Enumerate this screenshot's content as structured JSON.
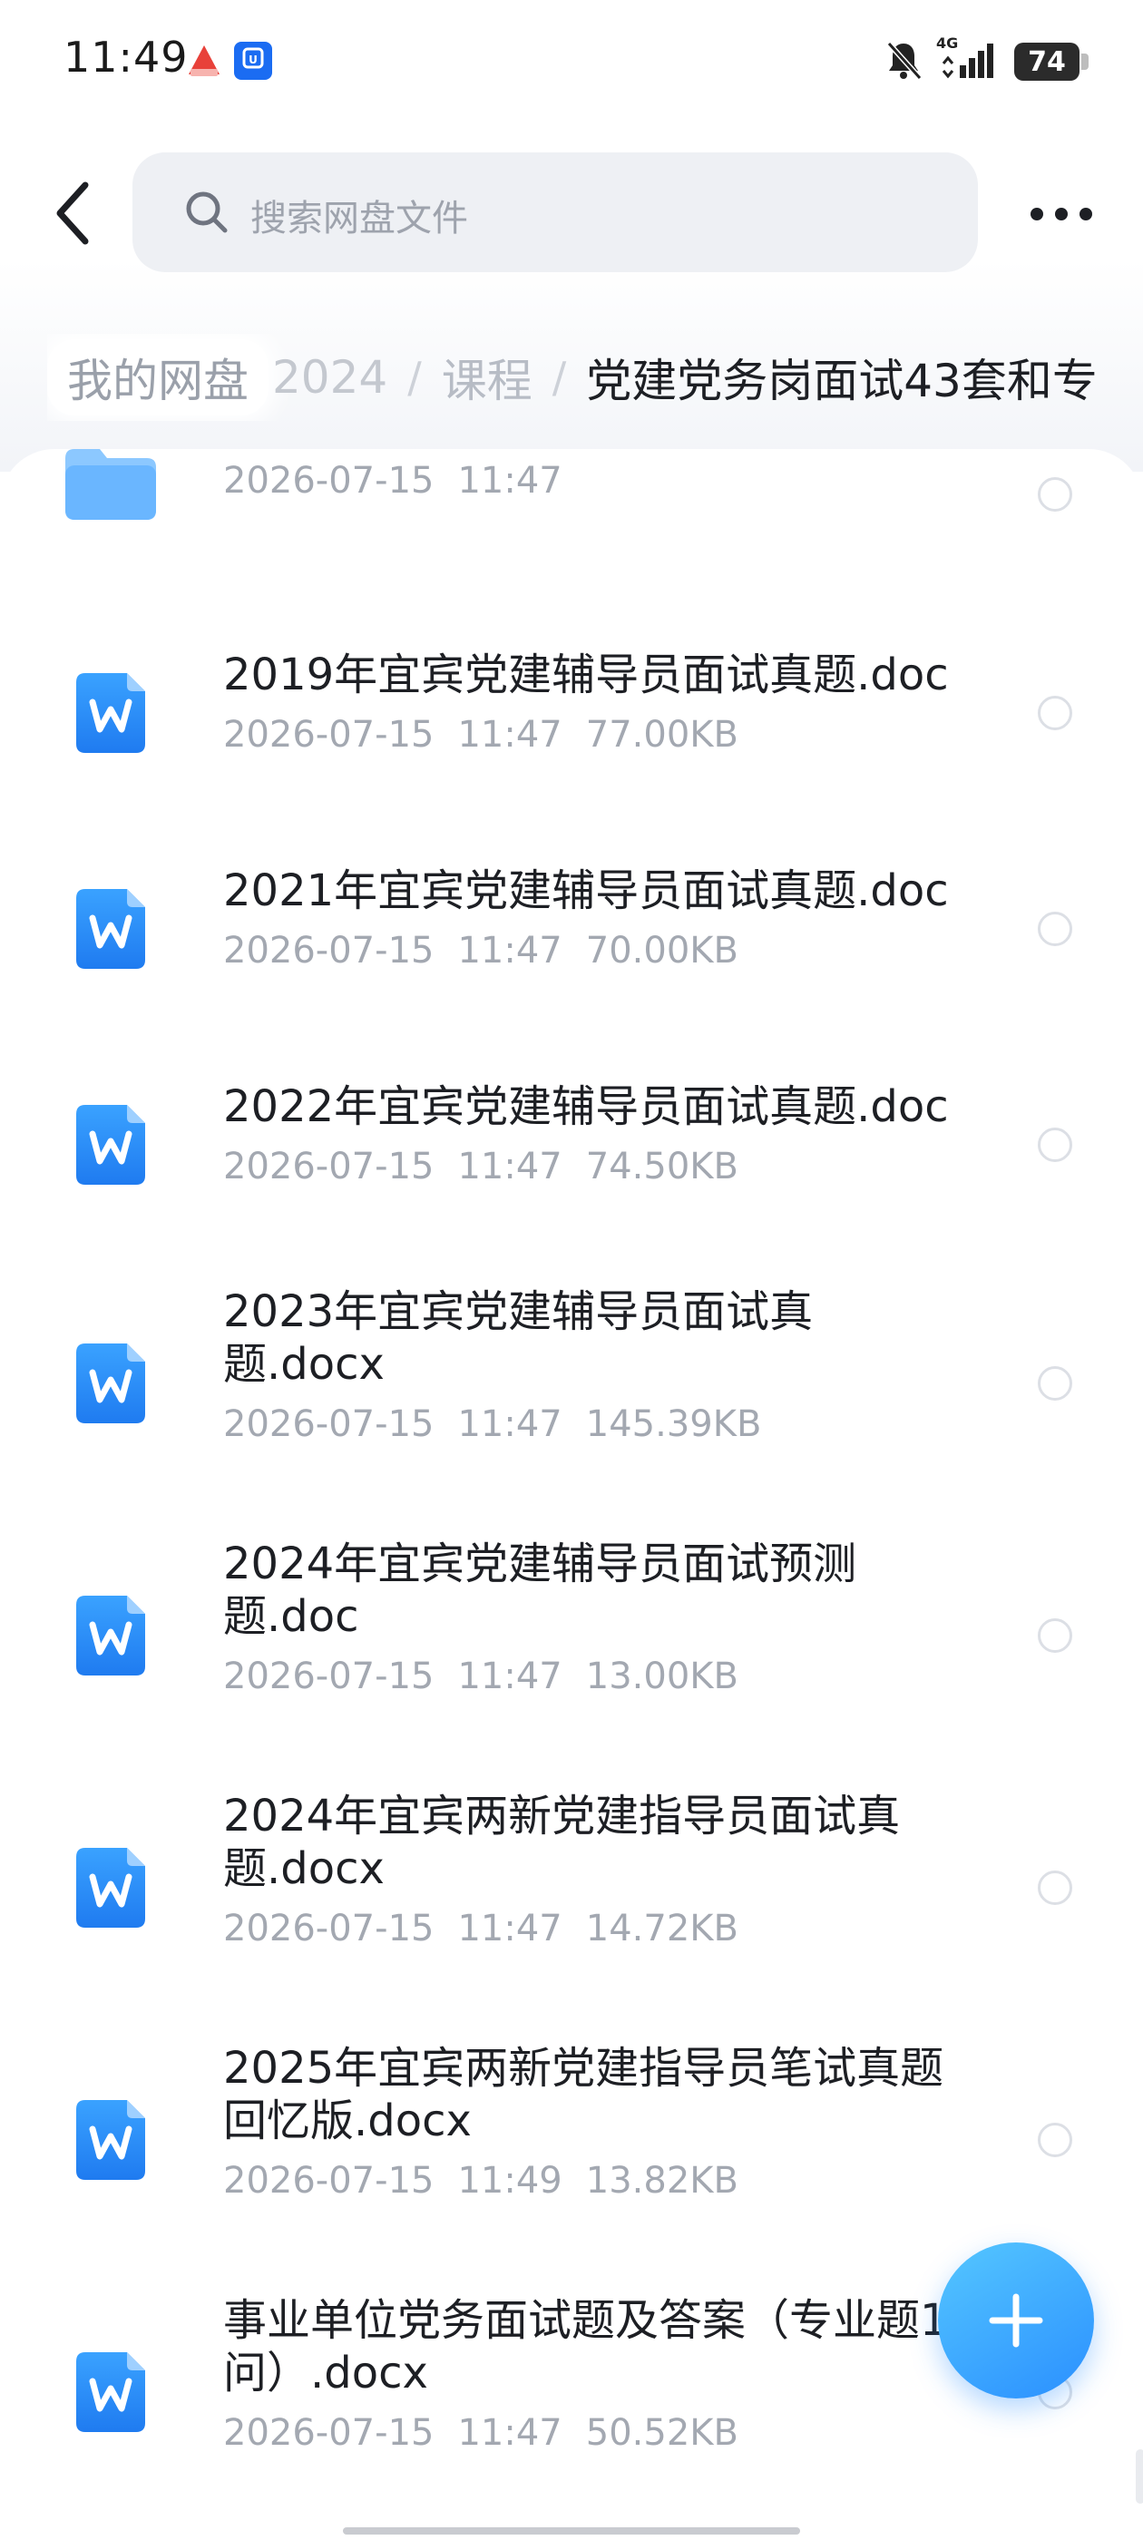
{
  "status_bar": {
    "time": "11:49",
    "network": "4G",
    "battery": "74",
    "icons": [
      "app-notification-icon",
      "app-shield-icon",
      "bell-muted-icon",
      "signal-icon",
      "battery-icon"
    ]
  },
  "header": {
    "search_placeholder": "搜索网盘文件",
    "icons": [
      "back-arrow-icon",
      "search-icon",
      "more-dots-icon"
    ]
  },
  "breadcrumb": {
    "root": "我的网盘",
    "items": [
      "2024",
      "课程",
      "党建党务岗面试43套和专"
    ],
    "separator": "/"
  },
  "files": [
    {
      "name": "",
      "date": "2026-07-15",
      "time": "11:47",
      "size": "",
      "type": "folder"
    },
    {
      "name": "2019年宜宾党建辅导员面试真题.doc",
      "date": "2026-07-15",
      "time": "11:47",
      "size": "77.00KB",
      "type": "word"
    },
    {
      "name": "2021年宜宾党建辅导员面试真题.doc",
      "date": "2026-07-15",
      "time": "11:47",
      "size": "70.00KB",
      "type": "word"
    },
    {
      "name": "2022年宜宾党建辅导员面试真题.doc",
      "date": "2026-07-15",
      "time": "11:47",
      "size": "74.50KB",
      "type": "word"
    },
    {
      "name": "2023年宜宾党建辅导员面试真题.docx",
      "date": "2026-07-15",
      "time": "11:47",
      "size": "145.39KB",
      "type": "word"
    },
    {
      "name": "2024年宜宾党建辅导员面试预测题.doc",
      "date": "2026-07-15",
      "time": "11:47",
      "size": "13.00KB",
      "type": "word"
    },
    {
      "name": "2024年宜宾两新党建指导员面试真题.docx",
      "date": "2026-07-15",
      "time": "11:47",
      "size": "14.72KB",
      "type": "word"
    },
    {
      "name": "2025年宜宾两新党建指导员笔试真题回忆版.docx",
      "date": "2026-07-15",
      "time": "11:49",
      "size": "13.82KB",
      "type": "word"
    },
    {
      "name": "事业单位党务面试题及答案（专业题1问）.docx",
      "date": "2026-07-15",
      "time": "11:47",
      "size": "50.52KB",
      "type": "word"
    }
  ],
  "fab": {
    "icon": "plus-icon"
  },
  "colors": {
    "accent": "#2a8fff",
    "word_icon_top": "#3aa2ff",
    "word_icon_bottom": "#1f7bf0",
    "folder": "#7fc0ff",
    "meta_text": "#a3a8b1"
  }
}
